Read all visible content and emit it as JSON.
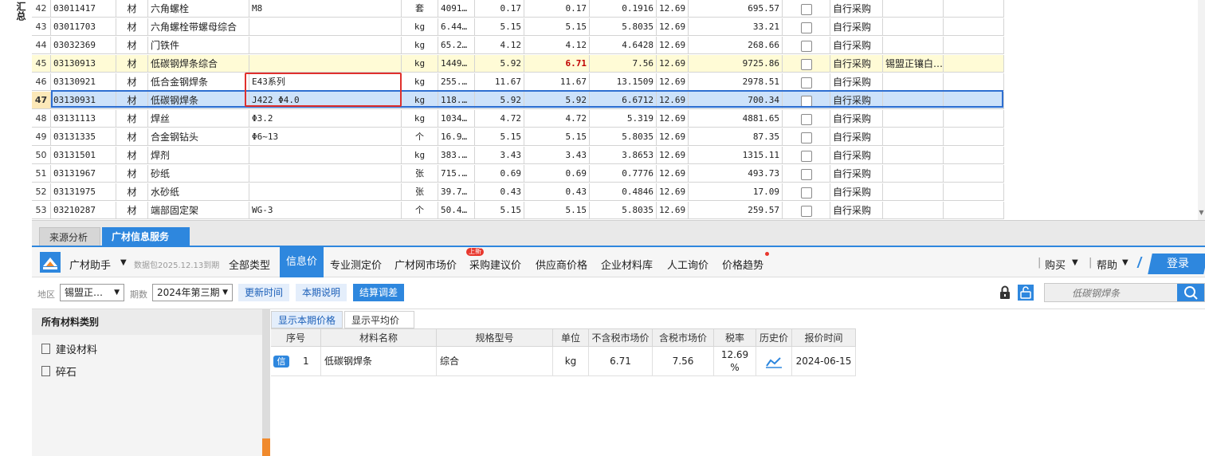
{
  "left_strip": {
    "label": "汇总"
  },
  "grid": {
    "rows": [
      {
        "no": "42",
        "code": "03011417",
        "type": "材",
        "name": "六角螺栓",
        "spec": "M8",
        "unit": "套",
        "qty": "4091…",
        "p1": "0.17",
        "p2": "0.17",
        "p3": "0.1916",
        "tax": "12.69",
        "amount": "695.57",
        "source": "自行采购",
        "note": ""
      },
      {
        "no": "43",
        "code": "03011703",
        "type": "材",
        "name": "六角螺栓带螺母综合",
        "spec": "",
        "unit": "kg",
        "qty": "6.44…",
        "p1": "5.15",
        "p2": "5.15",
        "p3": "5.8035",
        "tax": "12.69",
        "amount": "33.21",
        "source": "自行采购",
        "note": ""
      },
      {
        "no": "44",
        "code": "03032369",
        "type": "材",
        "name": "门铁件",
        "spec": "",
        "unit": "kg",
        "qty": "65.2…",
        "p1": "4.12",
        "p2": "4.12",
        "p3": "4.6428",
        "tax": "12.69",
        "amount": "268.66",
        "source": "自行采购",
        "note": ""
      },
      {
        "no": "45",
        "code": "03130913",
        "type": "材",
        "name": "低碳钢焊条综合",
        "spec": "",
        "unit": "kg",
        "qty": "1449…",
        "p1": "5.92",
        "p2": "6.71",
        "p3": "7.56",
        "tax": "12.69",
        "amount": "9725.86",
        "source": "自行采购",
        "note": "锡盟正镶白…"
      },
      {
        "no": "46",
        "code": "03130921",
        "type": "材",
        "name": "低合金钢焊条",
        "spec": "E43系列",
        "unit": "kg",
        "qty": "255.…",
        "p1": "11.67",
        "p2": "11.67",
        "p3": "13.1509",
        "tax": "12.69",
        "amount": "2978.51",
        "source": "自行采购",
        "note": ""
      },
      {
        "no": "47",
        "code": "03130931",
        "type": "材",
        "name": "低碳钢焊条",
        "spec": "J422 Φ4.0",
        "unit": "kg",
        "qty": "118.…",
        "p1": "5.92",
        "p2": "5.92",
        "p3": "6.6712",
        "tax": "12.69",
        "amount": "700.34",
        "source": "自行采购",
        "note": ""
      },
      {
        "no": "48",
        "code": "03131113",
        "type": "材",
        "name": "焊丝",
        "spec": "Φ3.2",
        "unit": "kg",
        "qty": "1034…",
        "p1": "4.72",
        "p2": "4.72",
        "p3": "5.319",
        "tax": "12.69",
        "amount": "4881.65",
        "source": "自行采购",
        "note": ""
      },
      {
        "no": "49",
        "code": "03131335",
        "type": "材",
        "name": "合金钢钻头",
        "spec": "Φ6~13",
        "unit": "个",
        "qty": "16.9…",
        "p1": "5.15",
        "p2": "5.15",
        "p3": "5.8035",
        "tax": "12.69",
        "amount": "87.35",
        "source": "自行采购",
        "note": ""
      },
      {
        "no": "50",
        "code": "03131501",
        "type": "材",
        "name": "焊剂",
        "spec": "",
        "unit": "kg",
        "qty": "383.…",
        "p1": "3.43",
        "p2": "3.43",
        "p3": "3.8653",
        "tax": "12.69",
        "amount": "1315.11",
        "source": "自行采购",
        "note": ""
      },
      {
        "no": "51",
        "code": "03131967",
        "type": "材",
        "name": "砂纸",
        "spec": "",
        "unit": "张",
        "qty": "715.…",
        "p1": "0.69",
        "p2": "0.69",
        "p3": "0.7776",
        "tax": "12.69",
        "amount": "493.73",
        "source": "自行采购",
        "note": ""
      },
      {
        "no": "52",
        "code": "03131975",
        "type": "材",
        "name": "水砂纸",
        "spec": "",
        "unit": "张",
        "qty": "39.7…",
        "p1": "0.43",
        "p2": "0.43",
        "p3": "0.4846",
        "tax": "12.69",
        "amount": "17.09",
        "source": "自行采购",
        "note": ""
      },
      {
        "no": "53",
        "code": "03210287",
        "type": "材",
        "name": "端部固定架",
        "spec": "WG-3",
        "unit": "个",
        "qty": "50.4…",
        "p1": "5.15",
        "p2": "5.15",
        "p3": "5.8035",
        "tax": "12.69",
        "amount": "259.57",
        "source": "自行采购",
        "note": ""
      }
    ]
  },
  "bottom_tabs": {
    "source": "来源分析",
    "service": "广材信息服务"
  },
  "toolbar": {
    "brand": "广材助手",
    "data_expiry": "数据包2025.12.13到期",
    "items": [
      "全部类型",
      "信息价",
      "专业测定价",
      "广材网市场价",
      "采购建议价",
      "供应商价格",
      "企业材料库",
      "人工询价",
      "价格趋势"
    ],
    "new_badge": "上新",
    "buy": "购买",
    "help": "帮助",
    "login": "登录"
  },
  "filter": {
    "region_label": "地区",
    "region_value": "锡盟正…",
    "period_label": "期数",
    "period_value": "2024年第三期",
    "update_time": "更新时间",
    "period_note": "本期说明",
    "settle": "结算调差",
    "search_placeholder": "低碳钢焊条"
  },
  "categories": {
    "header": "所有材料类别",
    "items": [
      "建设材料",
      "碎石"
    ]
  },
  "results": {
    "tab_current": "显示本期价格",
    "tab_avg": "显示平均价",
    "headers": [
      "序号",
      "材料名称",
      "规格型号",
      "单位",
      "不含税市场价",
      "含税市场价",
      "税率",
      "历史价",
      "报价时间"
    ],
    "row": {
      "badge": "信",
      "index": "1",
      "name": "低碳钢焊条",
      "spec": "综合",
      "unit": "kg",
      "price_ex_tax": "6.71",
      "price_inc_tax": "7.56",
      "tax_rate_line1": "12.69",
      "tax_rate_line2": "%",
      "quote_time": "2024-06-15"
    }
  },
  "colors": {
    "accent": "#2e87de",
    "selected_row": "#cde2fa",
    "highlight_row": "#fffbd6",
    "red_box": "#e0302c"
  }
}
